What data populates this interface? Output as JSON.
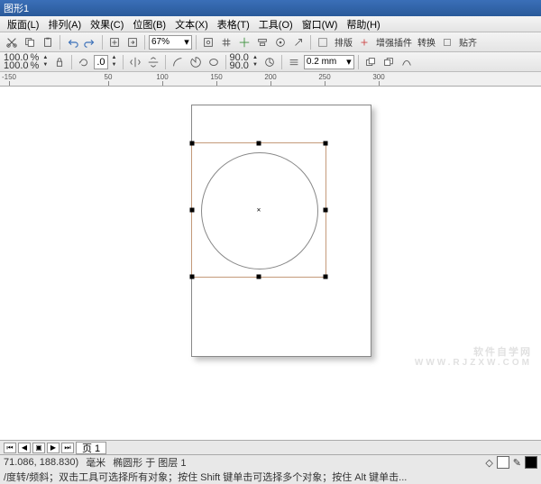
{
  "titlebar": {
    "title": "图形1"
  },
  "menu": {
    "items": [
      "版面(L)",
      "排列(A)",
      "效果(C)",
      "位图(B)",
      "文本(X)",
      "表格(T)",
      "工具(O)",
      "窗口(W)",
      "帮助(H)"
    ]
  },
  "toolbar1": {
    "zoom": "67%",
    "labels": {
      "pailie": "排版",
      "zengqiang": "增强插件",
      "zhuanhuan": "转换",
      "tieqi": "贴齐"
    }
  },
  "toolbar2": {
    "scaleX": "100.0",
    "scaleXunit": "%",
    "scaleY": "100.0",
    "scaleYunit": "%",
    "rotation": ".0",
    "rot90a": "90.0",
    "rot90b": "90.0",
    "outline": "0.2 mm"
  },
  "ruler": {
    "ticks": [
      "-150",
      "50",
      "100",
      "150",
      "200",
      "250",
      "300"
    ]
  },
  "tabs": {
    "page1": "页 1"
  },
  "status": {
    "coords": "71.086, 188.830)",
    "unit": "毫米",
    "objinfo": "椭圆形 于 图层 1",
    "hint": "/度转/频斜；双击工具可选择所有对象；按住 Shift 键单击可选择多个对象；按住 Alt 键单击..."
  },
  "watermark": {
    "l1": "软件自学网",
    "l2": "WWW.RJZXW.COM"
  }
}
